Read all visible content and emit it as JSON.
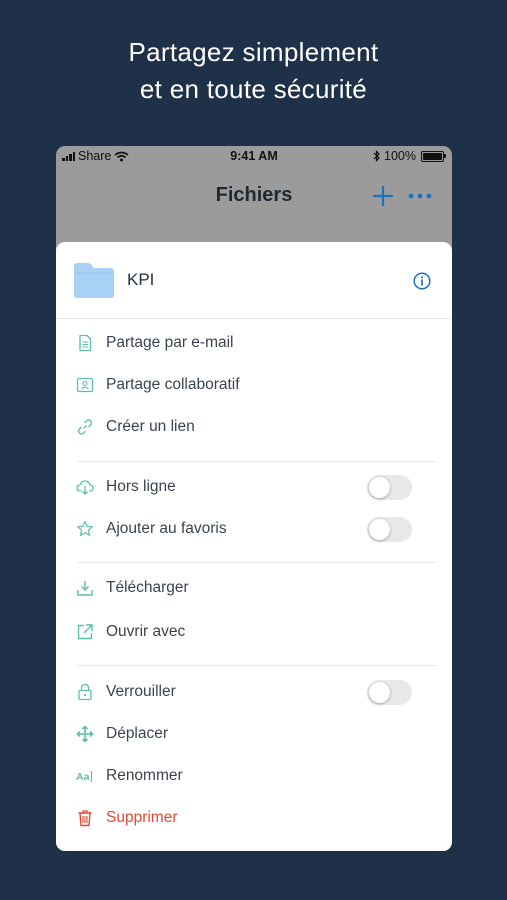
{
  "headline": {
    "line1": "Partagez simplement",
    "line2": "et en toute sécurité"
  },
  "status_bar": {
    "carrier": "Share",
    "time": "9:41 AM",
    "battery": "100%"
  },
  "nav": {
    "title": "Fichiers",
    "add_icon": "plus-icon",
    "more_icon": "more-icon"
  },
  "file": {
    "name": "KPI",
    "icon": "folder-icon",
    "info_icon": "info-icon"
  },
  "actions": {
    "share_email": "Partage par e-mail",
    "share_collab": "Partage collaboratif",
    "create_link": "Créer un lien",
    "offline": "Hors ligne",
    "favorite": "Ajouter au favoris",
    "download": "Télécharger",
    "open_with": "Ouvrir avec",
    "lock": "Verrouiller",
    "move": "Déplacer",
    "rename": "Renommer",
    "delete": "Supprimer"
  },
  "toggles": {
    "offline": false,
    "favorite": false,
    "lock": false
  },
  "colors": {
    "background": "#1f3149",
    "accent": "#1f6fc0",
    "icon_green": "#5cc0a4",
    "danger": "#e24a33",
    "folder": "#a9d1f5"
  }
}
